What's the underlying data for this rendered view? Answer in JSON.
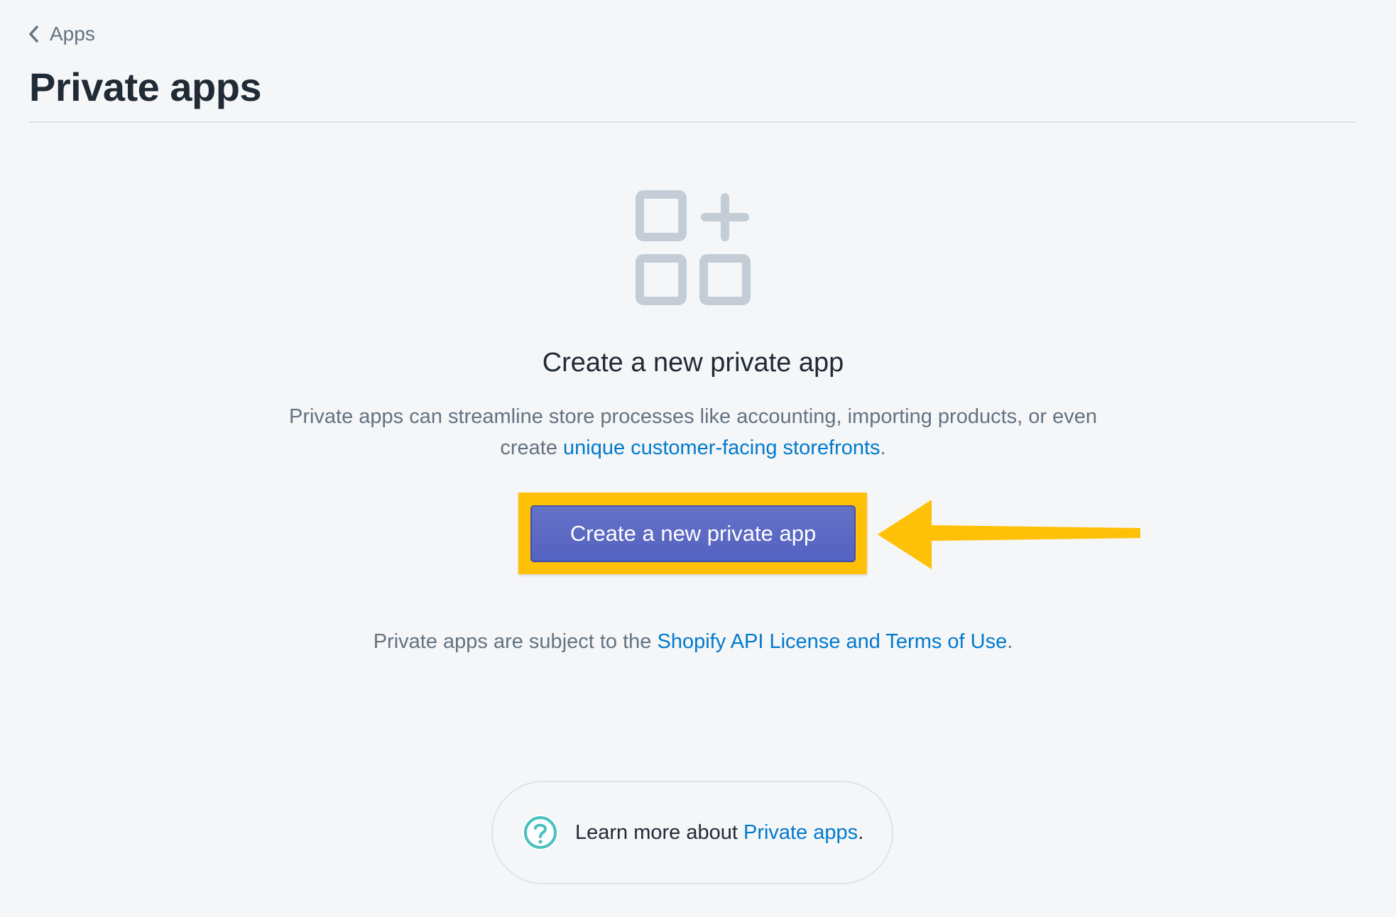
{
  "header": {
    "breadcrumb_label": "Apps",
    "title": "Private apps"
  },
  "empty_state": {
    "heading": "Create a new private app",
    "description_prefix": "Private apps can streamline store processes like accounting, importing products, or even create ",
    "description_link": "unique customer-facing storefronts",
    "description_suffix": ".",
    "button_label": "Create a new private app",
    "terms_prefix": "Private apps are subject to the ",
    "terms_link": "Shopify API License and Terms of Use",
    "terms_suffix": "."
  },
  "footer": {
    "prefix": "Learn more about ",
    "link": "Private apps",
    "suffix": "."
  },
  "icons": {
    "breadcrumb": "chevron-left-icon",
    "empty_state": "apps-add-icon",
    "footer": "question-circle-icon"
  },
  "colors": {
    "background": "#f5f6f8",
    "title": "#212b36",
    "muted_text": "#637381",
    "link": "#007ace",
    "primary_button": "#5c6ac4",
    "highlight": "#ffc107",
    "icon_gray": "#c4cdd5",
    "help_teal": "#47c1bf"
  }
}
